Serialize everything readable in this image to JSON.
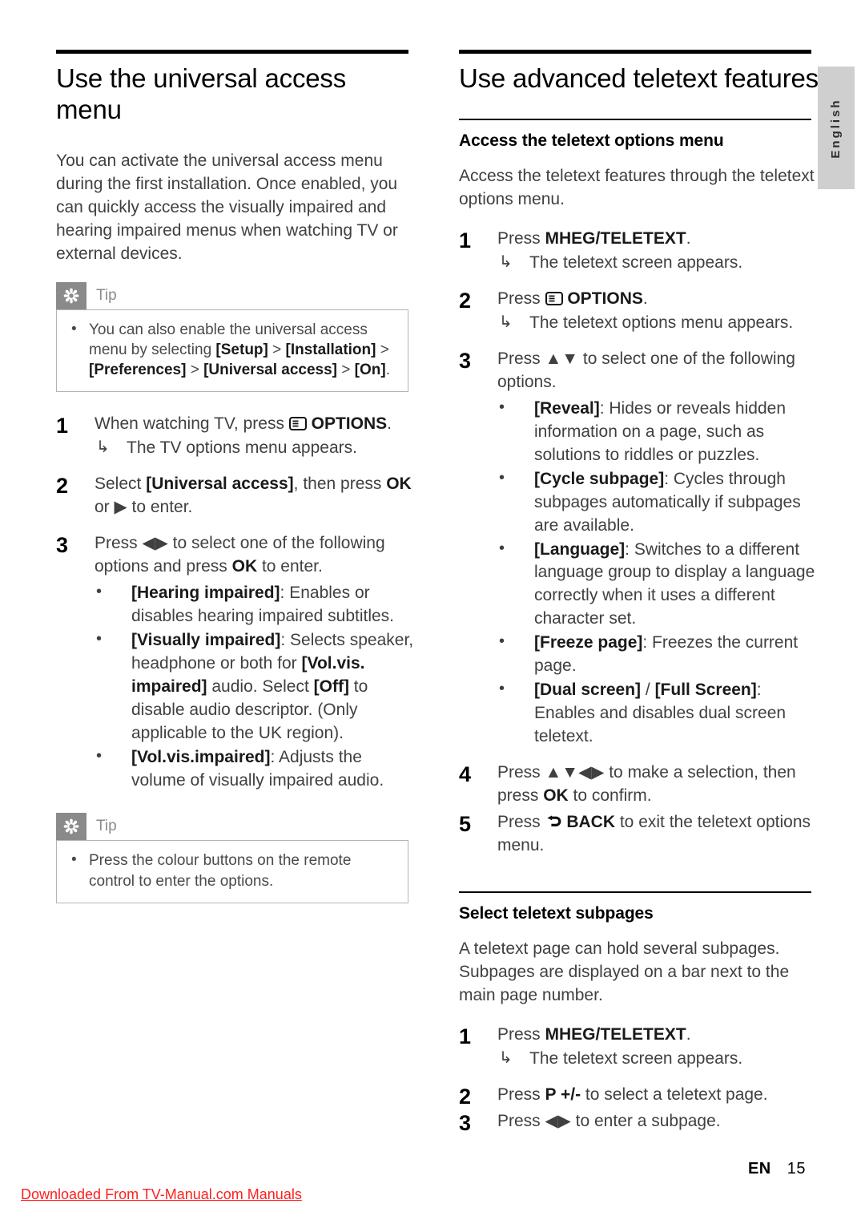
{
  "language_tab": {
    "label": "English"
  },
  "footer": {
    "lang_code": "EN",
    "page_number": "15",
    "watermark": "Downloaded From TV-Manual.com Manuals"
  },
  "left_column": {
    "title": "Use the universal access menu",
    "intro": "You can activate the universal access menu during the first installation. Once enabled, you can quickly access the visually impaired and hearing impaired menus when watching TV or external devices.",
    "tip_top": {
      "label": "Tip",
      "icon": "asterisk-icon",
      "items": [
        {
          "parts": [
            {
              "text": "You can also enable the universal access menu by selecting ",
              "bold": false
            },
            {
              "text": "[Setup]",
              "bold": true
            },
            {
              "text": " > ",
              "bold": false
            },
            {
              "text": "[Installation]",
              "bold": true
            },
            {
              "text": " > ",
              "bold": false
            },
            {
              "text": "[Preferences]",
              "bold": true
            },
            {
              "text": " > ",
              "bold": false
            },
            {
              "text": "[Universal access]",
              "bold": true
            },
            {
              "text": " > ",
              "bold": false
            },
            {
              "text": "[On]",
              "bold": true
            },
            {
              "text": ".",
              "bold": false
            }
          ]
        }
      ]
    },
    "steps": [
      {
        "num": "1",
        "parts": [
          {
            "text": "When watching TV, press ",
            "bold": false
          },
          {
            "icon": "options-icon"
          },
          {
            "text": " OPTIONS",
            "bold": true
          },
          {
            "text": ".",
            "bold": false
          }
        ],
        "result": "The TV options menu appears."
      },
      {
        "num": "2",
        "parts": [
          {
            "text": "Select ",
            "bold": false
          },
          {
            "text": "[Universal access]",
            "bold": true
          },
          {
            "text": ", then press ",
            "bold": false
          },
          {
            "text": "OK",
            "bold": true
          },
          {
            "text": " or ▶ to enter.",
            "bold": false
          }
        ]
      },
      {
        "num": "3",
        "parts": [
          {
            "text": "Press ◀▶ to select one of the following options and press ",
            "bold": false
          },
          {
            "text": "OK",
            "bold": true
          },
          {
            "text": " to enter.",
            "bold": false
          }
        ],
        "bullets": [
          {
            "parts": [
              {
                "text": "[Hearing impaired]",
                "bold": true
              },
              {
                "text": ": Enables or disables hearing impaired subtitles.",
                "bold": false
              }
            ]
          },
          {
            "parts": [
              {
                "text": "[Visually impaired]",
                "bold": true
              },
              {
                "text": ": Selects speaker, headphone or both for ",
                "bold": false
              },
              {
                "text": "[Vol.vis. impaired]",
                "bold": true
              },
              {
                "text": " audio. Select ",
                "bold": false
              },
              {
                "text": "[Off]",
                "bold": true
              },
              {
                "text": " to disable audio descriptor. (Only applicable to the UK region).",
                "bold": false
              }
            ]
          },
          {
            "parts": [
              {
                "text": "[Vol.vis.impaired]",
                "bold": true
              },
              {
                "text": ": Adjusts the volume of visually impaired audio.",
                "bold": false
              }
            ]
          }
        ]
      }
    ],
    "tip_bottom": {
      "label": "Tip",
      "icon": "asterisk-icon",
      "items": [
        {
          "parts": [
            {
              "text": "Press the colour buttons on the remote control to enter the options.",
              "bold": false
            }
          ]
        }
      ]
    }
  },
  "right_column": {
    "title": "Use advanced teletext features",
    "section_1": {
      "heading": "Access the teletext options menu",
      "intro": "Access the teletext features through the teletext options menu.",
      "steps": [
        {
          "num": "1",
          "parts": [
            {
              "text": "Press ",
              "bold": false
            },
            {
              "text": "MHEG/TELETEXT",
              "bold": true
            },
            {
              "text": ".",
              "bold": false
            }
          ],
          "result": "The teletext screen appears."
        },
        {
          "num": "2",
          "parts": [
            {
              "text": "Press ",
              "bold": false
            },
            {
              "icon": "options-icon"
            },
            {
              "text": " OPTIONS",
              "bold": true
            },
            {
              "text": ".",
              "bold": false
            }
          ],
          "result": "The teletext options menu appears."
        },
        {
          "num": "3",
          "parts": [
            {
              "text": "Press ▲▼ to select one of the following options.",
              "bold": false
            }
          ],
          "bullets": [
            {
              "parts": [
                {
                  "text": "[Reveal]",
                  "bold": true
                },
                {
                  "text": ": Hides or reveals hidden information on a page, such as solutions to riddles or puzzles.",
                  "bold": false
                }
              ]
            },
            {
              "parts": [
                {
                  "text": "[Cycle subpage]",
                  "bold": true
                },
                {
                  "text": ": Cycles through subpages automatically if subpages are available.",
                  "bold": false
                }
              ]
            },
            {
              "parts": [
                {
                  "text": "[Language]",
                  "bold": true
                },
                {
                  "text": ": Switches to a different language group to display a language correctly when it uses a different character set.",
                  "bold": false
                }
              ]
            },
            {
              "parts": [
                {
                  "text": "[Freeze page]",
                  "bold": true
                },
                {
                  "text": ": Freezes the current page.",
                  "bold": false
                }
              ]
            },
            {
              "parts": [
                {
                  "text": "[Dual screen]",
                  "bold": true
                },
                {
                  "text": " / ",
                  "bold": false
                },
                {
                  "text": "[Full Screen]",
                  "bold": true
                },
                {
                  "text": ": Enables and disables dual screen teletext.",
                  "bold": false
                }
              ]
            }
          ]
        },
        {
          "num": "4",
          "parts": [
            {
              "text": "Press ▲▼◀▶ to make a selection, then press ",
              "bold": false
            },
            {
              "text": "OK",
              "bold": true
            },
            {
              "text": " to confirm.",
              "bold": false
            }
          ]
        },
        {
          "num": "5",
          "parts": [
            {
              "text": "Press ",
              "bold": false
            },
            {
              "icon": "back-icon"
            },
            {
              "text": " BACK",
              "bold": true
            },
            {
              "text": " to exit the teletext options menu.",
              "bold": false
            }
          ]
        }
      ]
    },
    "section_2": {
      "heading": "Select teletext subpages",
      "intro": "A teletext page can hold several subpages. Subpages are displayed on a bar next to the main page number.",
      "steps": [
        {
          "num": "1",
          "parts": [
            {
              "text": "Press ",
              "bold": false
            },
            {
              "text": "MHEG/TELETEXT",
              "bold": true
            },
            {
              "text": ".",
              "bold": false
            }
          ],
          "result": "The teletext screen appears."
        },
        {
          "num": "2",
          "parts": [
            {
              "text": "Press ",
              "bold": false
            },
            {
              "text": "P +/-",
              "bold": true
            },
            {
              "text": " to select a teletext page.",
              "bold": false
            }
          ]
        },
        {
          "num": "3",
          "parts": [
            {
              "text": "Press ◀▶ to enter a subpage.",
              "bold": false
            }
          ]
        }
      ]
    }
  }
}
